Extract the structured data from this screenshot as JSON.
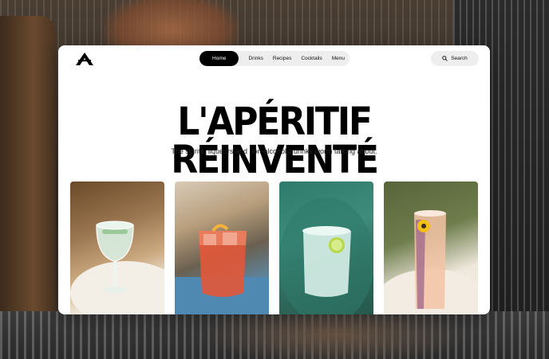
{
  "nav": {
    "items": [
      "Home",
      "Drinks",
      "Recipes",
      "Cocktails",
      "Menu"
    ],
    "active": "Home"
  },
  "search": {
    "label": "Search",
    "icon": "search-icon"
  },
  "hero": {
    "title": "L'APÉRITIF RÉINVENTÉ",
    "subtitle": "The spirits, liqueurs and non-alcoholic drinks worth talking about."
  },
  "photos": [
    {
      "name": "gin-tonic-photo"
    },
    {
      "name": "negroni-photo"
    },
    {
      "name": "highball-lime-photo"
    },
    {
      "name": "spritz-flower-photo"
    }
  ],
  "colors": {
    "nav_active_bg": "#000000",
    "nav_bg": "#eeeeee",
    "card_bg": "#ffffff"
  }
}
